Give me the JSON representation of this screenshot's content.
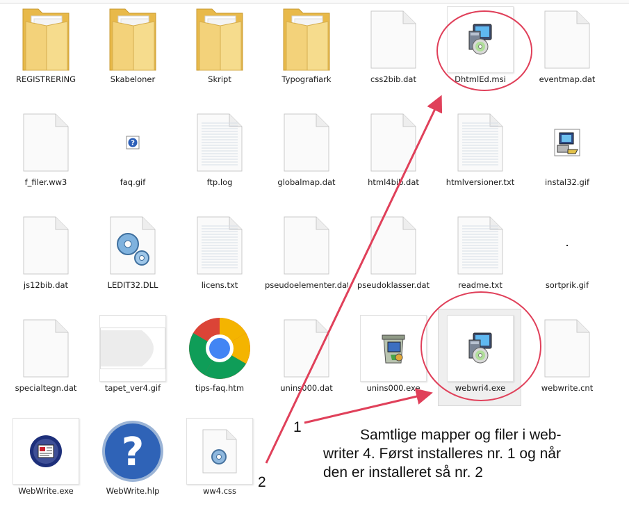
{
  "files": [
    {
      "name": "REGISTRERING",
      "icon": "folder-icon"
    },
    {
      "name": "Skabeloner",
      "icon": "folder-icon"
    },
    {
      "name": "Skript",
      "icon": "folder-icon"
    },
    {
      "name": "Typografiark",
      "icon": "folder-icon"
    },
    {
      "name": "css2bib.dat",
      "icon": "blank-file-icon"
    },
    {
      "name": "DhtmlEd.msi",
      "icon": "installer-icon"
    },
    {
      "name": "eventmap.dat",
      "icon": "blank-file-icon"
    },
    {
      "name": "f_filer.ww3",
      "icon": "blank-file-icon"
    },
    {
      "name": "faq.gif",
      "icon": "help-gif-icon"
    },
    {
      "name": "ftp.log",
      "icon": "text-file-icon"
    },
    {
      "name": "globalmap.dat",
      "icon": "blank-file-icon"
    },
    {
      "name": "html4bib.dat",
      "icon": "blank-file-icon"
    },
    {
      "name": "htmlversioner.txt",
      "icon": "text-file-icon"
    },
    {
      "name": "instal32.gif",
      "icon": "setup-gif-icon"
    },
    {
      "name": "js12bib.dat",
      "icon": "blank-file-icon"
    },
    {
      "name": "LEDIT32.DLL",
      "icon": "dll-gears-icon"
    },
    {
      "name": "licens.txt",
      "icon": "text-file-icon"
    },
    {
      "name": "pseudoelementer.dat",
      "icon": "blank-file-icon"
    },
    {
      "name": "pseudoklasser.dat",
      "icon": "blank-file-icon"
    },
    {
      "name": "readme.txt",
      "icon": "text-file-icon"
    },
    {
      "name": "sortprik.gif",
      "icon": "dot-gif-icon"
    },
    {
      "name": "specialtegn.dat",
      "icon": "blank-file-icon"
    },
    {
      "name": "tapet_ver4.gif",
      "icon": "wallpaper-gif-icon"
    },
    {
      "name": "tips-faq.htm",
      "icon": "chrome-icon"
    },
    {
      "name": "unins000.dat",
      "icon": "blank-file-icon"
    },
    {
      "name": "unins000.exe",
      "icon": "uninstaller-icon"
    },
    {
      "name": "webwri4.exe",
      "icon": "installer-icon",
      "selected": true
    },
    {
      "name": "webwrite.cnt",
      "icon": "blank-file-icon"
    },
    {
      "name": "WebWrite.exe",
      "icon": "webwrite-app-icon"
    },
    {
      "name": "WebWrite.hlp",
      "icon": "help-question-icon"
    },
    {
      "name": "ww4.css",
      "icon": "css-gear-file-icon"
    }
  ],
  "annotation": {
    "marker_1": "1",
    "marker_2": "2",
    "text_lines": [
      "Samtlige mapper og filer i web-",
      "writer 4. Først installeres nr. 1 og når",
      "den er installeret så nr. 2"
    ],
    "color": "#e0405a"
  }
}
